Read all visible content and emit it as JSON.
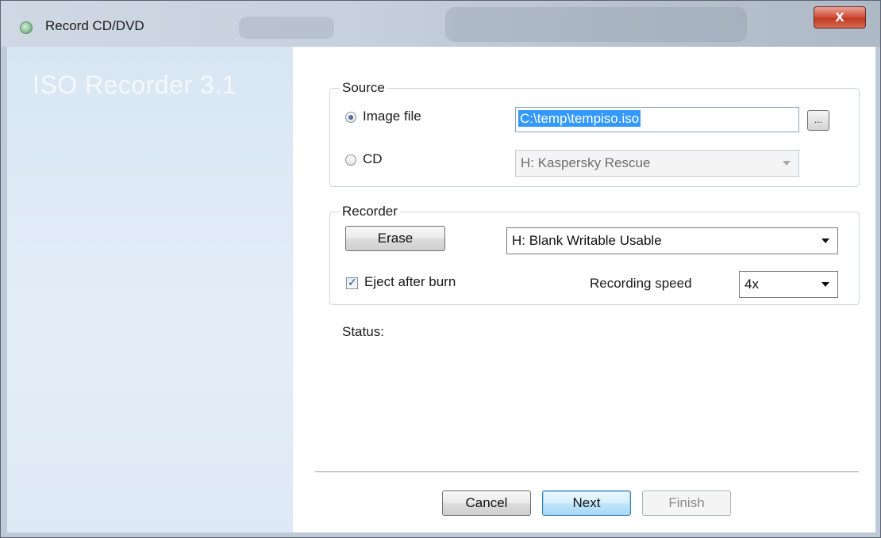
{
  "window": {
    "title": "Record CD/DVD",
    "close_label": "x"
  },
  "sidebar": {
    "title": "ISO Recorder 3.1"
  },
  "source": {
    "legend": "Source",
    "image_file_label": "Image file",
    "image_file_selected": true,
    "image_path": "C:\\temp\\tempiso.iso",
    "browse_label": "...",
    "cd_label": "CD",
    "cd_drive": "H: Kaspersky Rescue"
  },
  "recorder": {
    "legend": "Recorder",
    "erase_label": "Erase",
    "drive": "H: Blank Writable Usable",
    "eject_label": "Eject after burn",
    "eject_checked": true,
    "speed_label": "Recording speed",
    "speed": "4x"
  },
  "status": {
    "label": "Status:"
  },
  "footer": {
    "cancel_label": "Cancel",
    "next_label": "Next",
    "finish_label": "Finish"
  }
}
